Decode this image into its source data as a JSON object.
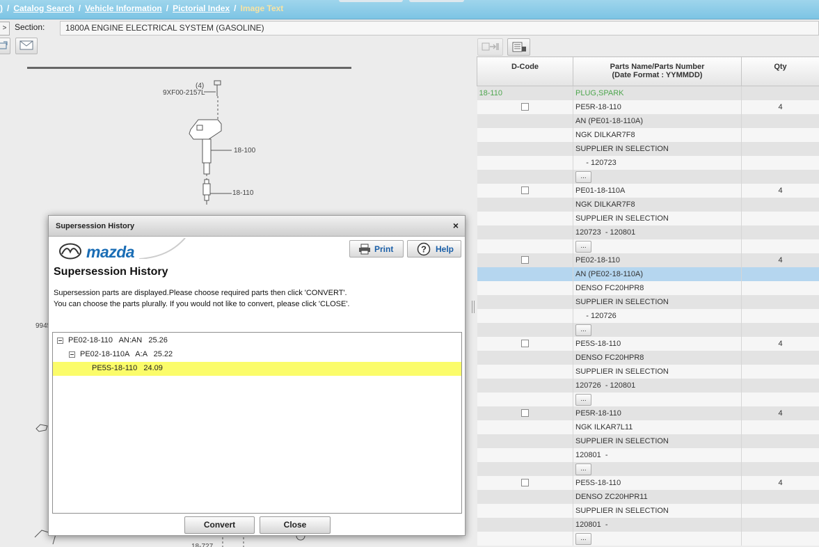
{
  "breadcrumb": {
    "lead": ")",
    "items": [
      "Catalog Search",
      "Vehicle Information",
      "Pictorial Index"
    ],
    "current": "Image Text",
    "separator": "/"
  },
  "section": {
    "nav_glyph": ">",
    "label": "Section:",
    "value": "1800A  ENGINE ELECTRICAL SYSTEM (GASOLINE)"
  },
  "drawing": {
    "labels": {
      "bolt_qty": "(4)",
      "bolt_part": "9XF00-2157L",
      "coil": "18-100",
      "plug": "18-110",
      "partial_left": "9945",
      "partial_bottom": "18-727"
    }
  },
  "parts_table": {
    "headers": {
      "dcode": "D-Code",
      "name_line1": "Parts Name/Parts Number",
      "name_line2": "(Date Format : YYMMDD)",
      "qty": "Qty"
    },
    "ellipsis": "...",
    "rows": [
      {
        "style": "green",
        "dcode": "18-110",
        "name": "PLUG,SPARK",
        "qty": ""
      },
      {
        "style": "light",
        "check": true,
        "name": "PE5R-18-110",
        "qty": "4"
      },
      {
        "style": "dark",
        "name": "AN (PE01-18-110A)",
        "qty": ""
      },
      {
        "style": "light",
        "name": "NGK DILKAR7F8",
        "qty": ""
      },
      {
        "style": "dark",
        "name": "SUPPLIER IN SELECTION",
        "qty": ""
      },
      {
        "style": "light",
        "name": "     - 120723",
        "qty": ""
      },
      {
        "style": "dark",
        "ellipsis": true,
        "name": "",
        "qty": ""
      },
      {
        "style": "light",
        "check": true,
        "name": "PE01-18-110A",
        "qty": "4"
      },
      {
        "style": "dark",
        "name": "NGK DILKAR7F8",
        "qty": ""
      },
      {
        "style": "light",
        "name": "SUPPLIER IN SELECTION",
        "qty": ""
      },
      {
        "style": "dark",
        "name": "120723  - 120801",
        "qty": ""
      },
      {
        "style": "light",
        "ellipsis": true,
        "name": "",
        "qty": ""
      },
      {
        "style": "dark",
        "check": true,
        "name": "PE02-18-110",
        "qty": "4"
      },
      {
        "style": "sel",
        "name": "AN (PE02-18-110A)",
        "qty": ""
      },
      {
        "style": "light",
        "name": "DENSO FC20HPR8",
        "qty": ""
      },
      {
        "style": "dark",
        "name": "SUPPLIER IN SELECTION",
        "qty": ""
      },
      {
        "style": "light",
        "name": "     - 120726",
        "qty": ""
      },
      {
        "style": "dark",
        "ellipsis": true,
        "name": "",
        "qty": ""
      },
      {
        "style": "light",
        "check": true,
        "name": "PE5S-18-110",
        "qty": "4"
      },
      {
        "style": "dark",
        "name": "DENSO FC20HPR8",
        "qty": ""
      },
      {
        "style": "light",
        "name": "SUPPLIER IN SELECTION",
        "qty": ""
      },
      {
        "style": "dark",
        "name": "120726  - 120801",
        "qty": ""
      },
      {
        "style": "light",
        "ellipsis": true,
        "name": "",
        "qty": ""
      },
      {
        "style": "dark",
        "check": true,
        "name": "PE5R-18-110",
        "qty": "4"
      },
      {
        "style": "light",
        "name": "NGK ILKAR7L11",
        "qty": ""
      },
      {
        "style": "dark",
        "name": "SUPPLIER IN SELECTION",
        "qty": ""
      },
      {
        "style": "light",
        "name": "120801  -",
        "qty": ""
      },
      {
        "style": "dark",
        "ellipsis": true,
        "name": "",
        "qty": ""
      },
      {
        "style": "light",
        "check": true,
        "name": "PE5S-18-110",
        "qty": "4"
      },
      {
        "style": "dark",
        "name": "DENSO ZC20HPR11",
        "qty": ""
      },
      {
        "style": "light",
        "name": "SUPPLIER IN SELECTION",
        "qty": ""
      },
      {
        "style": "dark",
        "name": "120801  -",
        "qty": ""
      },
      {
        "style": "light",
        "ellipsis": true,
        "name": "",
        "qty": ""
      }
    ]
  },
  "modal": {
    "title": "Supersession History",
    "close_glyph": "×",
    "brand": "mazda",
    "print_label": "Print",
    "help_label": "Help",
    "heading": "Supersession History",
    "desc_line1": "Supersession parts are displayed.Please choose required parts then click 'CONVERT'.",
    "desc_line2": "You can choose the parts plurally. If you would not like to convert, please click 'CLOSE'.",
    "tree": [
      {
        "text": "PE02-18-110   AN:AN   25.26",
        "level": 0,
        "collapsible": true,
        "highlight": false
      },
      {
        "text": "PE02-18-110A   A:A   25.22",
        "level": 1,
        "collapsible": true,
        "highlight": false
      },
      {
        "text": "PE5S-18-110   24.09",
        "level": 2,
        "collapsible": false,
        "highlight": true
      }
    ],
    "convert_label": "Convert",
    "close_label": "Close"
  },
  "colors": {
    "header_bar": "#7cc4e4",
    "selected_row": "#b5d6ef",
    "highlight_row": "#fbfc6a",
    "brand_blue": "#1a6db5",
    "category_green": "#4ea64e"
  },
  "icons": {
    "print": "printer-icon",
    "help": "question-icon",
    "mail": "envelope-icon",
    "export": "export-icon",
    "list": "list-icon"
  }
}
